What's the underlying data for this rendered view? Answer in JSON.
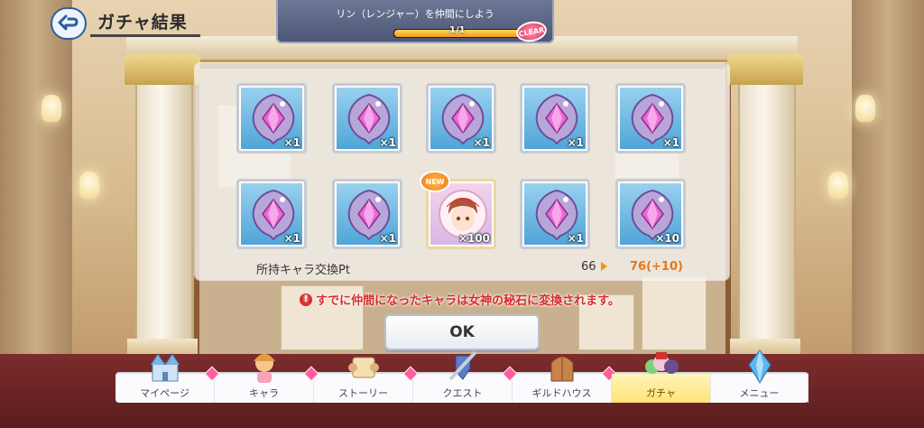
{
  "header": {
    "title": "ガチャ結果",
    "back_icon": "back-arrow-icon"
  },
  "mission": {
    "text": "リン（レンジャー）を仲間にしよう",
    "progress_label": "1/1",
    "progress_fraction": 1.0,
    "clear_badge": "CLEAR"
  },
  "results": {
    "items": [
      {
        "type": "memory-piece",
        "qty": "×1"
      },
      {
        "type": "memory-piece",
        "qty": "×1"
      },
      {
        "type": "memory-piece",
        "qty": "×1"
      },
      {
        "type": "memory-piece",
        "qty": "×1"
      },
      {
        "type": "memory-piece",
        "qty": "×1"
      },
      {
        "type": "memory-piece",
        "qty": "×1"
      },
      {
        "type": "memory-piece",
        "qty": "×1"
      },
      {
        "type": "character",
        "qty": "×100",
        "badge": "NEW"
      },
      {
        "type": "memory-piece",
        "qty": "×1"
      },
      {
        "type": "memory-piece",
        "qty": "×10"
      }
    ],
    "pt_label": "所持キャラ交換Pt",
    "pt_old": "66",
    "pt_new": "76(+10)"
  },
  "notice": {
    "icon": "!",
    "text": "すでに仲間になったキャラは女神の秘石に変換されます。"
  },
  "ok_label": "OK",
  "nav": {
    "items": [
      {
        "label": "マイページ",
        "icon": "castle-icon",
        "active": false
      },
      {
        "label": "キャラ",
        "icon": "character-icon",
        "active": false
      },
      {
        "label": "ストーリー",
        "icon": "scroll-icon",
        "active": false
      },
      {
        "label": "クエスト",
        "icon": "sword-shield-icon",
        "active": false
      },
      {
        "label": "ギルドハウス",
        "icon": "guild-door-icon",
        "active": false
      },
      {
        "label": "ガチャ",
        "icon": "gacha-characters-icon",
        "active": true
      },
      {
        "label": "メニュー",
        "icon": "crystal-icon",
        "active": false
      }
    ]
  },
  "colors": {
    "accent_orange": "#e3781a",
    "notice_red": "#d92b2b",
    "item_bg": "#4ea3d8",
    "active_tab": "#ffe37a"
  }
}
